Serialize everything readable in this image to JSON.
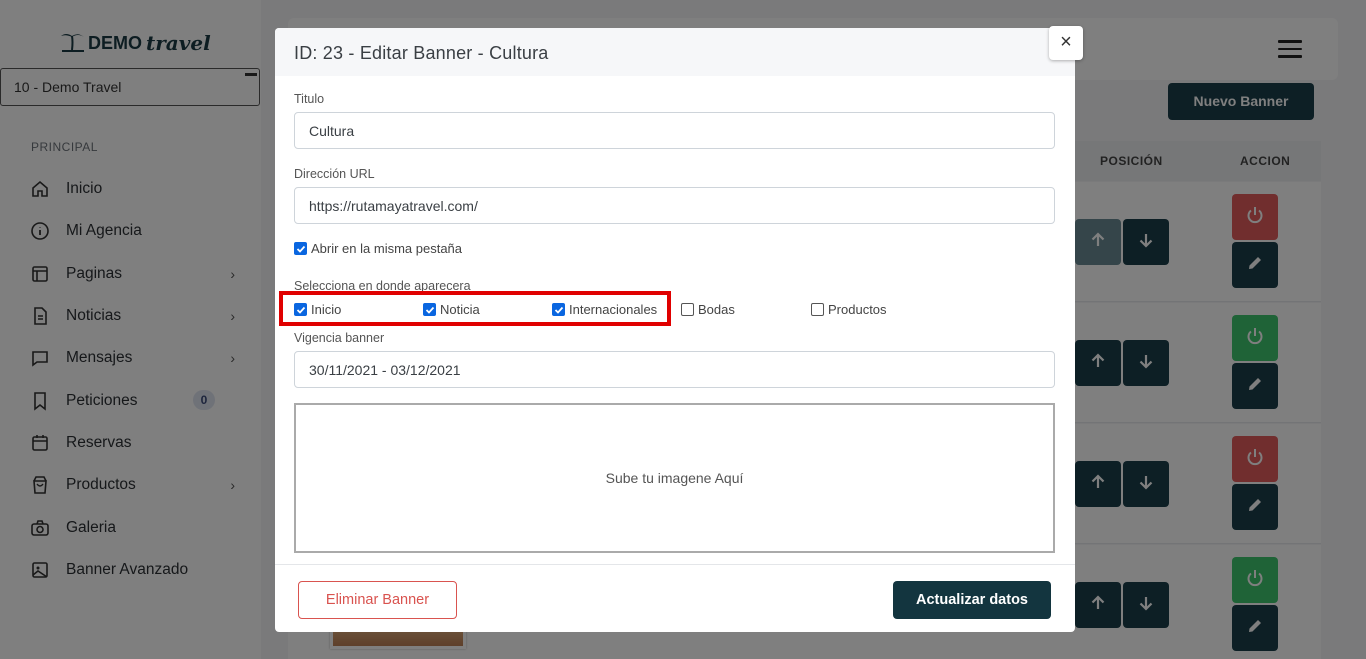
{
  "sidebar": {
    "logo_text_demo": "DEMO",
    "logo_text_travel": "travel",
    "agency_select": "10 - Demo Travel",
    "section_title": "PRINCIPAL",
    "items": [
      {
        "label": "Inicio",
        "icon": "home-icon",
        "has_chevron": false
      },
      {
        "label": "Mi Agencia",
        "icon": "info-icon",
        "has_chevron": false
      },
      {
        "label": "Paginas",
        "icon": "layout-icon",
        "has_chevron": true
      },
      {
        "label": "Noticias",
        "icon": "file-text-icon",
        "has_chevron": true
      },
      {
        "label": "Mensajes",
        "icon": "message-icon",
        "has_chevron": true
      },
      {
        "label": "Peticiones",
        "icon": "bookmark-icon",
        "has_chevron": false,
        "badge": "0"
      },
      {
        "label": "Reservas",
        "icon": "calendar-icon",
        "has_chevron": false
      },
      {
        "label": "Productos",
        "icon": "shopping-bag-icon",
        "has_chevron": true
      },
      {
        "label": "Galeria",
        "icon": "camera-icon",
        "has_chevron": false
      },
      {
        "label": "Banner Avanzado",
        "icon": "image-icon",
        "has_chevron": false
      }
    ]
  },
  "main": {
    "new_banner_button": "Nuevo Banner",
    "table_headers": {
      "position": "POSICIÓN",
      "action": "ACCION"
    },
    "rows": [
      {
        "power": "red",
        "up_dim": true
      },
      {
        "power": "green",
        "up_dim": false
      },
      {
        "power": "red",
        "up_dim": false
      },
      {
        "power": "green",
        "up_dim": false
      }
    ]
  },
  "modal": {
    "title": "ID: 23 - Editar Banner - Cultura",
    "close_label": "×",
    "title_label": "Titulo",
    "title_value": "Cultura",
    "url_label": "Dirección URL",
    "url_value": "https://rutamayatravel.com/",
    "same_tab_label": "Abrir en la misma pestaña",
    "same_tab_checked": true,
    "where_label": "Selecciona en donde aparecera",
    "locations": [
      {
        "label": "Inicio",
        "checked": true
      },
      {
        "label": "Noticia",
        "checked": true
      },
      {
        "label": "Internacionales",
        "checked": true
      },
      {
        "label": "Bodas",
        "checked": false
      },
      {
        "label": "Productos",
        "checked": false
      }
    ],
    "validity_label": "Vigencia banner",
    "validity_value": "30/11/2021 - 03/12/2021",
    "upload_text": "Sube tu imagene Aquí",
    "delete_button": "Eliminar Banner",
    "update_button": "Actualizar datos"
  },
  "colors": {
    "primary_dark": "#1a3e4a",
    "danger": "#e35d5d",
    "success": "#3ec66e",
    "highlight": "#e00000",
    "checkbox": "#0a66e0"
  }
}
